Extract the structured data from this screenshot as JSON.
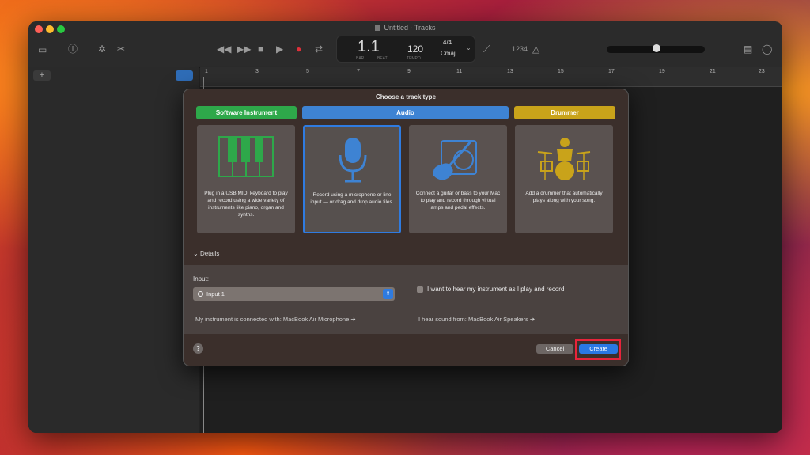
{
  "window": {
    "title": "Untitled - Tracks"
  },
  "lcd": {
    "bar": "1.1",
    "bar_label": "BAR",
    "beat_label": "BEAT",
    "tempo": "120",
    "tempo_label": "TEMPO",
    "signature": "4/4",
    "key": "Cmaj"
  },
  "toolbar": {
    "count_in": "1234"
  },
  "ruler": {
    "ticks": [
      "1",
      "3",
      "5",
      "7",
      "9",
      "11",
      "13",
      "15",
      "17",
      "19",
      "21",
      "23"
    ]
  },
  "dialog": {
    "title": "Choose a track type",
    "categories": [
      {
        "label": "Software Instrument",
        "color": "#2ea84a"
      },
      {
        "label": "Audio",
        "color": "#3e83d3"
      },
      {
        "label": "Drummer",
        "color": "#c9a31a"
      }
    ],
    "cards": [
      {
        "icon": "piano-keys-icon",
        "desc": "Plug in a USB MIDI keyboard to play and record using a wide variety of instruments like piano, organ and synths."
      },
      {
        "icon": "microphone-icon",
        "desc": "Record using a microphone or line input — or drag and drop audio files."
      },
      {
        "icon": "guitar-amp-icon",
        "desc": "Connect a guitar or bass to your Mac to play and record through virtual amps and pedal effects."
      },
      {
        "icon": "drummer-icon",
        "desc": "Add a drummer that automatically plays along with your song."
      }
    ],
    "details_label": "Details",
    "input_label": "Input:",
    "input_value": "Input 1",
    "monitor_label": "I want to hear my instrument as I play and record",
    "connected_text": "My instrument is connected with: MacBook Air Microphone",
    "output_text": "I hear sound from: MacBook Air Speakers",
    "cancel_label": "Cancel",
    "create_label": "Create",
    "help_label": "?"
  }
}
